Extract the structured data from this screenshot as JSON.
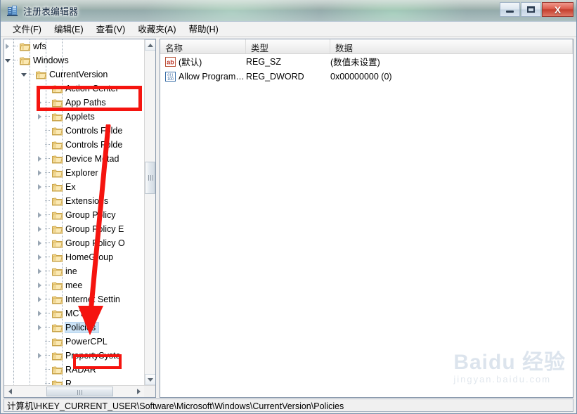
{
  "window": {
    "title": "注册表编辑器",
    "app_icon": "registry-editor-icon",
    "buttons": {
      "minimize": "最小化",
      "maximize": "最大化",
      "close": "关闭"
    }
  },
  "menu": {
    "items": [
      {
        "label": "文件(F)",
        "name": "menu-file"
      },
      {
        "label": "编辑(E)",
        "name": "menu-edit"
      },
      {
        "label": "查看(V)",
        "name": "menu-view"
      },
      {
        "label": "收藏夹(A)",
        "name": "menu-favorites"
      },
      {
        "label": "帮助(H)",
        "name": "menu-help"
      }
    ]
  },
  "tree": {
    "nodes": [
      {
        "label": "wfs",
        "depth": 1,
        "expander": "collapsed",
        "selected": false
      },
      {
        "label": "Windows",
        "depth": 1,
        "expander": "expanded",
        "selected": false
      },
      {
        "label": "CurrentVersion",
        "depth": 2,
        "expander": "expanded",
        "selected": false
      },
      {
        "label": "Action Center",
        "depth": 3,
        "expander": "collapsed",
        "selected": false
      },
      {
        "label": "App Paths",
        "depth": 3,
        "expander": "collapsed",
        "selected": false
      },
      {
        "label": "Applets",
        "depth": 3,
        "expander": "collapsed",
        "selected": false
      },
      {
        "label": "Controls Folde",
        "depth": 3,
        "expander": "none",
        "selected": false
      },
      {
        "label": "Controls Folde",
        "depth": 3,
        "expander": "none",
        "selected": false
      },
      {
        "label": "Device Metad",
        "depth": 3,
        "expander": "collapsed",
        "selected": false
      },
      {
        "label": "Explorer",
        "depth": 3,
        "expander": "collapsed",
        "selected": false
      },
      {
        "label": "Ex",
        "depth": 3,
        "expander": "collapsed",
        "selected": false
      },
      {
        "label": "Extensions",
        "depth": 3,
        "expander": "none",
        "selected": false
      },
      {
        "label": "Group Policy",
        "depth": 3,
        "expander": "collapsed",
        "selected": false
      },
      {
        "label": "Group Policy E",
        "depth": 3,
        "expander": "collapsed",
        "selected": false
      },
      {
        "label": "Group Policy O",
        "depth": 3,
        "expander": "collapsed",
        "selected": false
      },
      {
        "label": "HomeGroup",
        "depth": 3,
        "expander": "collapsed",
        "selected": false
      },
      {
        "label": "ine",
        "depth": 3,
        "expander": "collapsed",
        "selected": false
      },
      {
        "label": "mee",
        "depth": 3,
        "expander": "collapsed",
        "selected": false
      },
      {
        "label": "Internet Settin",
        "depth": 3,
        "expander": "collapsed",
        "selected": false
      },
      {
        "label": "MCT",
        "depth": 3,
        "expander": "collapsed",
        "selected": false
      },
      {
        "label": "Policies",
        "depth": 3,
        "expander": "collapsed",
        "selected": true
      },
      {
        "label": "PowerCPL",
        "depth": 3,
        "expander": "none",
        "selected": false
      },
      {
        "label": "PropertySyste",
        "depth": 3,
        "expander": "collapsed",
        "selected": false
      },
      {
        "label": "RADAR",
        "depth": 3,
        "expander": "none",
        "selected": false
      },
      {
        "label": "R",
        "depth": 3,
        "expander": "none",
        "selected": false
      }
    ]
  },
  "list": {
    "columns": [
      {
        "label": "名称",
        "name": "column-name"
      },
      {
        "label": "类型",
        "name": "column-type"
      },
      {
        "label": "数据",
        "name": "column-data"
      }
    ],
    "rows": [
      {
        "icon": "string-value-icon",
        "name": "(默认)",
        "type": "REG_SZ",
        "data": "(数值未设置)"
      },
      {
        "icon": "dword-value-icon",
        "name": "Allow Program…",
        "type": "REG_DWORD",
        "data": "0x00000000 (0)"
      }
    ]
  },
  "status": {
    "path": "计算机\\HKEY_CURRENT_USER\\Software\\Microsoft\\Windows\\CurrentVersion\\Policies"
  },
  "watermark": {
    "main": "Baidu 经验",
    "sub": "jingyan.baidu.com"
  },
  "annotations": {
    "color": "#f5140f",
    "box_top_target": "Windows / CurrentVersion",
    "box_bottom_target": "Policies",
    "arrow": "red-down-arrow"
  }
}
